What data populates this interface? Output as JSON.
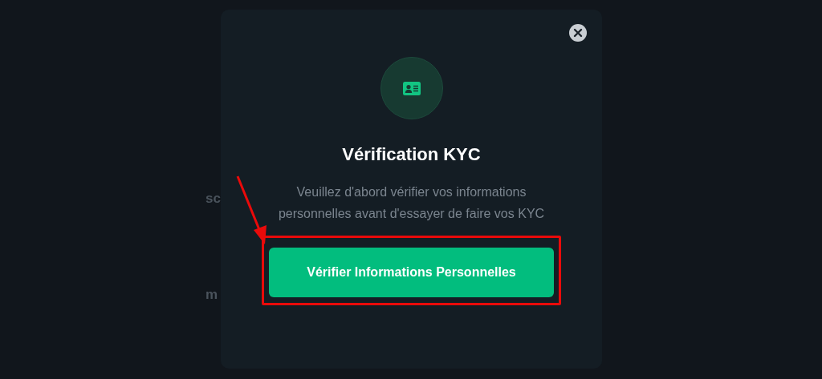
{
  "background_fragments": [
    "sc",
    "m"
  ],
  "modal": {
    "title": "Vérification KYC",
    "message": "Veuillez d'abord vérifier vos informations personnelles avant d'essayer de faire vos KYC",
    "button": "Vérifier Informations Personnelles",
    "highlighted": true
  }
}
